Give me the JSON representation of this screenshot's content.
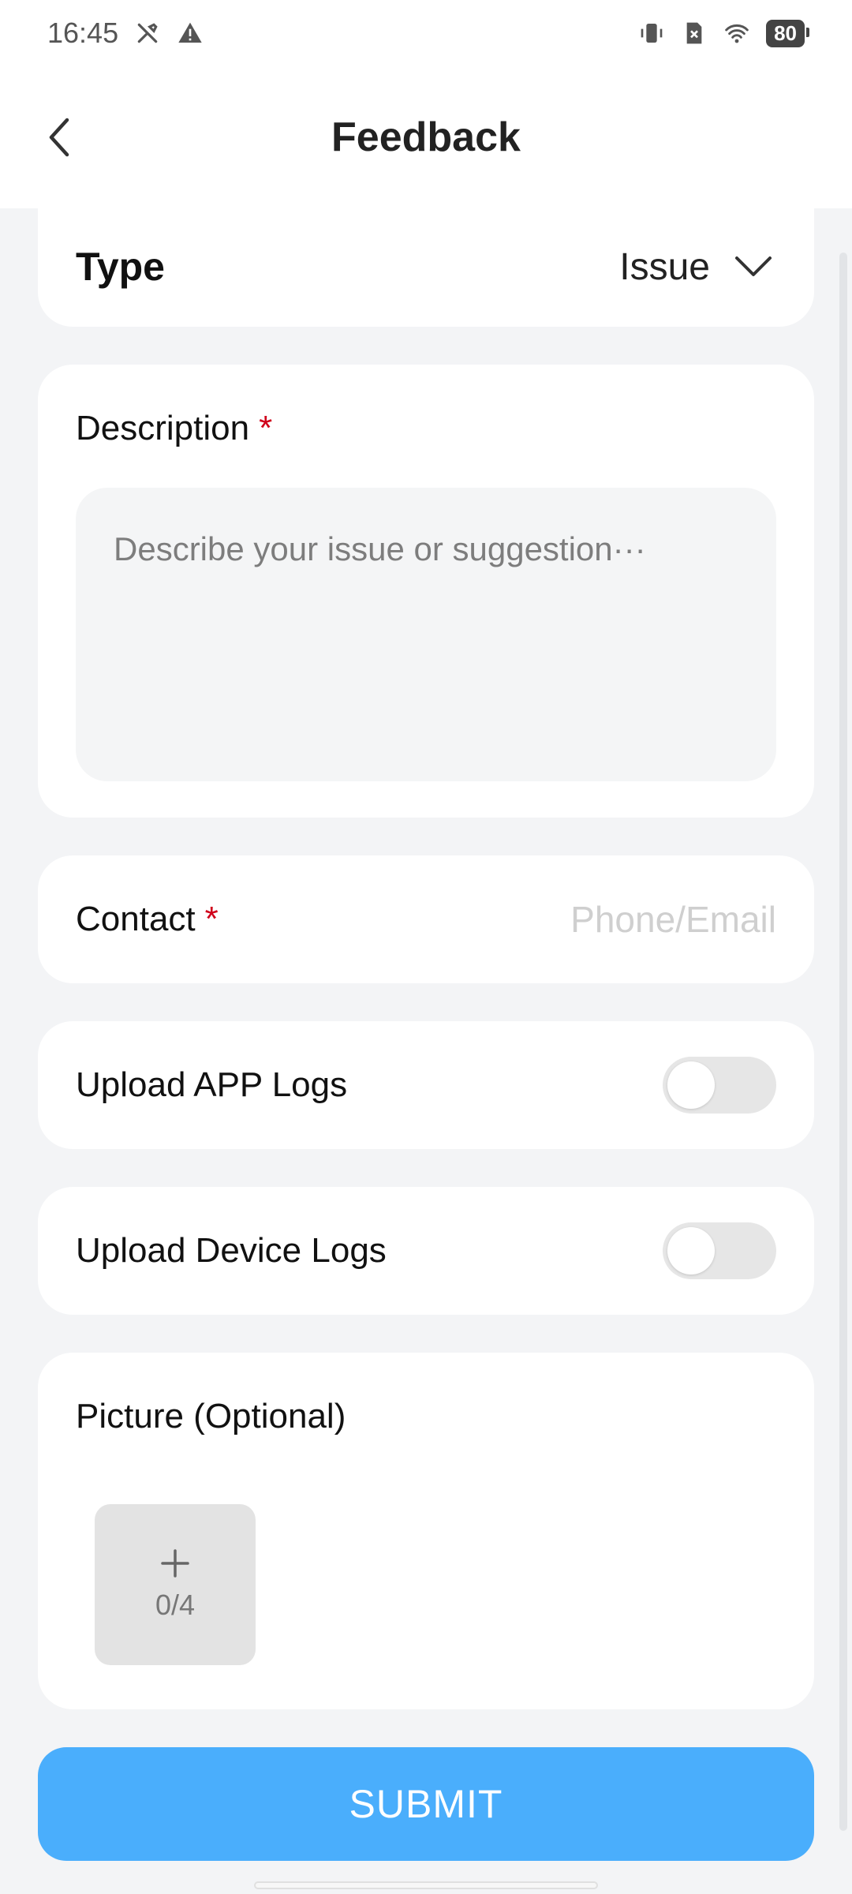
{
  "status_bar": {
    "time": "16:45",
    "left_icons": [
      "tools-icon",
      "warning-icon"
    ],
    "right_icons": [
      "vibrate-icon",
      "no-sim-icon",
      "wifi-icon"
    ],
    "battery": "80"
  },
  "header": {
    "title": "Feedback",
    "back_icon": "chevron-left-icon"
  },
  "type_row": {
    "label": "Type",
    "value": "Issue",
    "icon": "chevron-down-icon"
  },
  "description": {
    "label": "Description",
    "required_mark": "*",
    "placeholder": "Describe your issue or suggestion···",
    "value": ""
  },
  "contact": {
    "label": "Contact",
    "required_mark": "*",
    "placeholder": "Phone/Email",
    "value": ""
  },
  "upload_app_logs": {
    "label": "Upload APP Logs",
    "enabled": false
  },
  "upload_device_logs": {
    "label": "Upload Device Logs",
    "enabled": false
  },
  "picture": {
    "label": "Picture (Optional)",
    "add_icon": "plus-icon",
    "count": "0/4"
  },
  "submit": {
    "label": "SUBMIT"
  },
  "colors": {
    "accent": "#4aaefc",
    "required": "#d0021b",
    "background": "#f3f4f6"
  }
}
